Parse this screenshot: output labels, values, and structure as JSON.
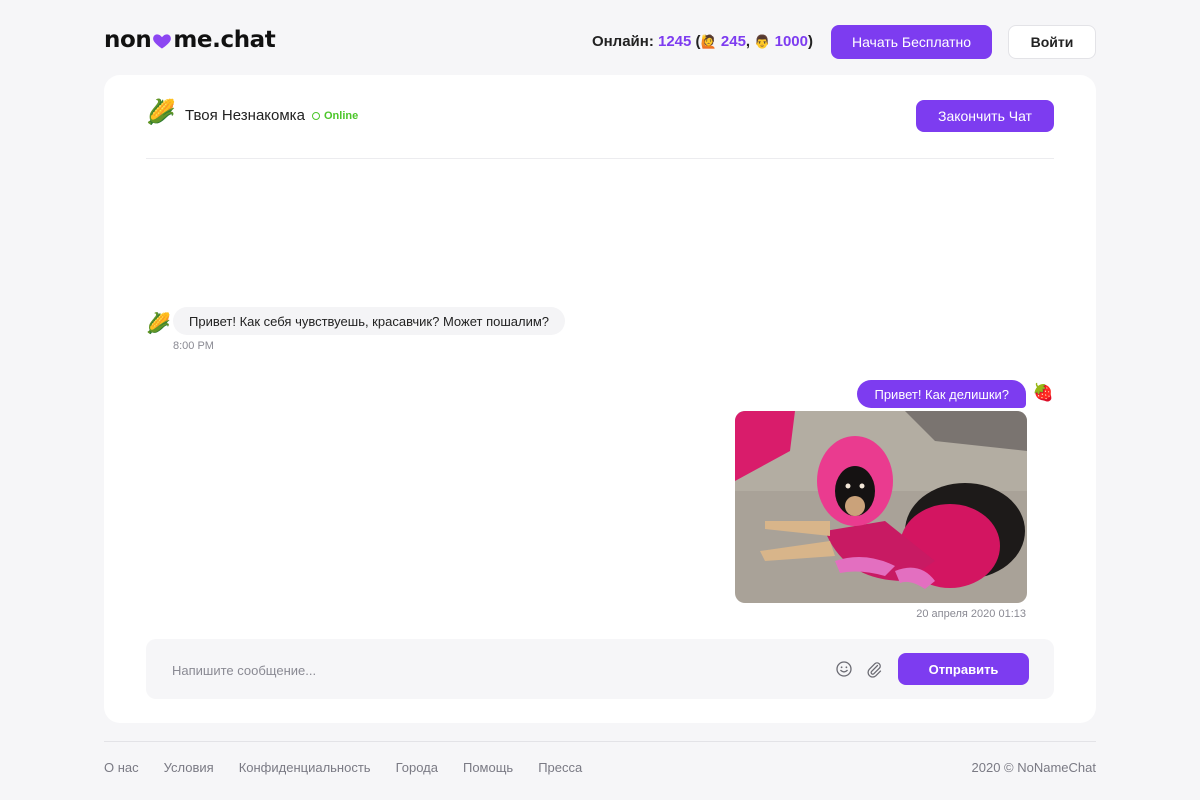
{
  "header": {
    "logo_left": "non",
    "logo_right": "me.chat",
    "online_label": "Онлайн:",
    "online_total": "1245",
    "online_girls": "245",
    "online_boys": "1000",
    "girls_emoji": "🙋",
    "boys_emoji": "👨",
    "start_label": "Начать Бесплатно",
    "login_label": "Войти"
  },
  "chat": {
    "partner_avatar": "🌽",
    "partner_name": "Твоя Незнакомка",
    "partner_status": "Online",
    "end_label": "Закончить Чат",
    "messages": [
      {
        "direction": "in",
        "avatar": "🌽",
        "text": "Привет! Как себя чувствуешь, красавчик? Может пошалим?",
        "time": "8:00 PM"
      },
      {
        "direction": "out",
        "avatar": "🍓",
        "text": "Привет! Как делишки?",
        "time": "20 апреля 2020 01:13"
      }
    ]
  },
  "composer": {
    "placeholder": "Напишите сообщение...",
    "send_label": "Отправить"
  },
  "footer": {
    "links": [
      "О нас",
      "Условия",
      "Конфиденциальность",
      "Города",
      "Помощь",
      "Пресса"
    ],
    "copyright": "2020 © NoNameChat"
  },
  "colors": {
    "accent": "#7d3cf0",
    "online": "#4cc62a"
  }
}
